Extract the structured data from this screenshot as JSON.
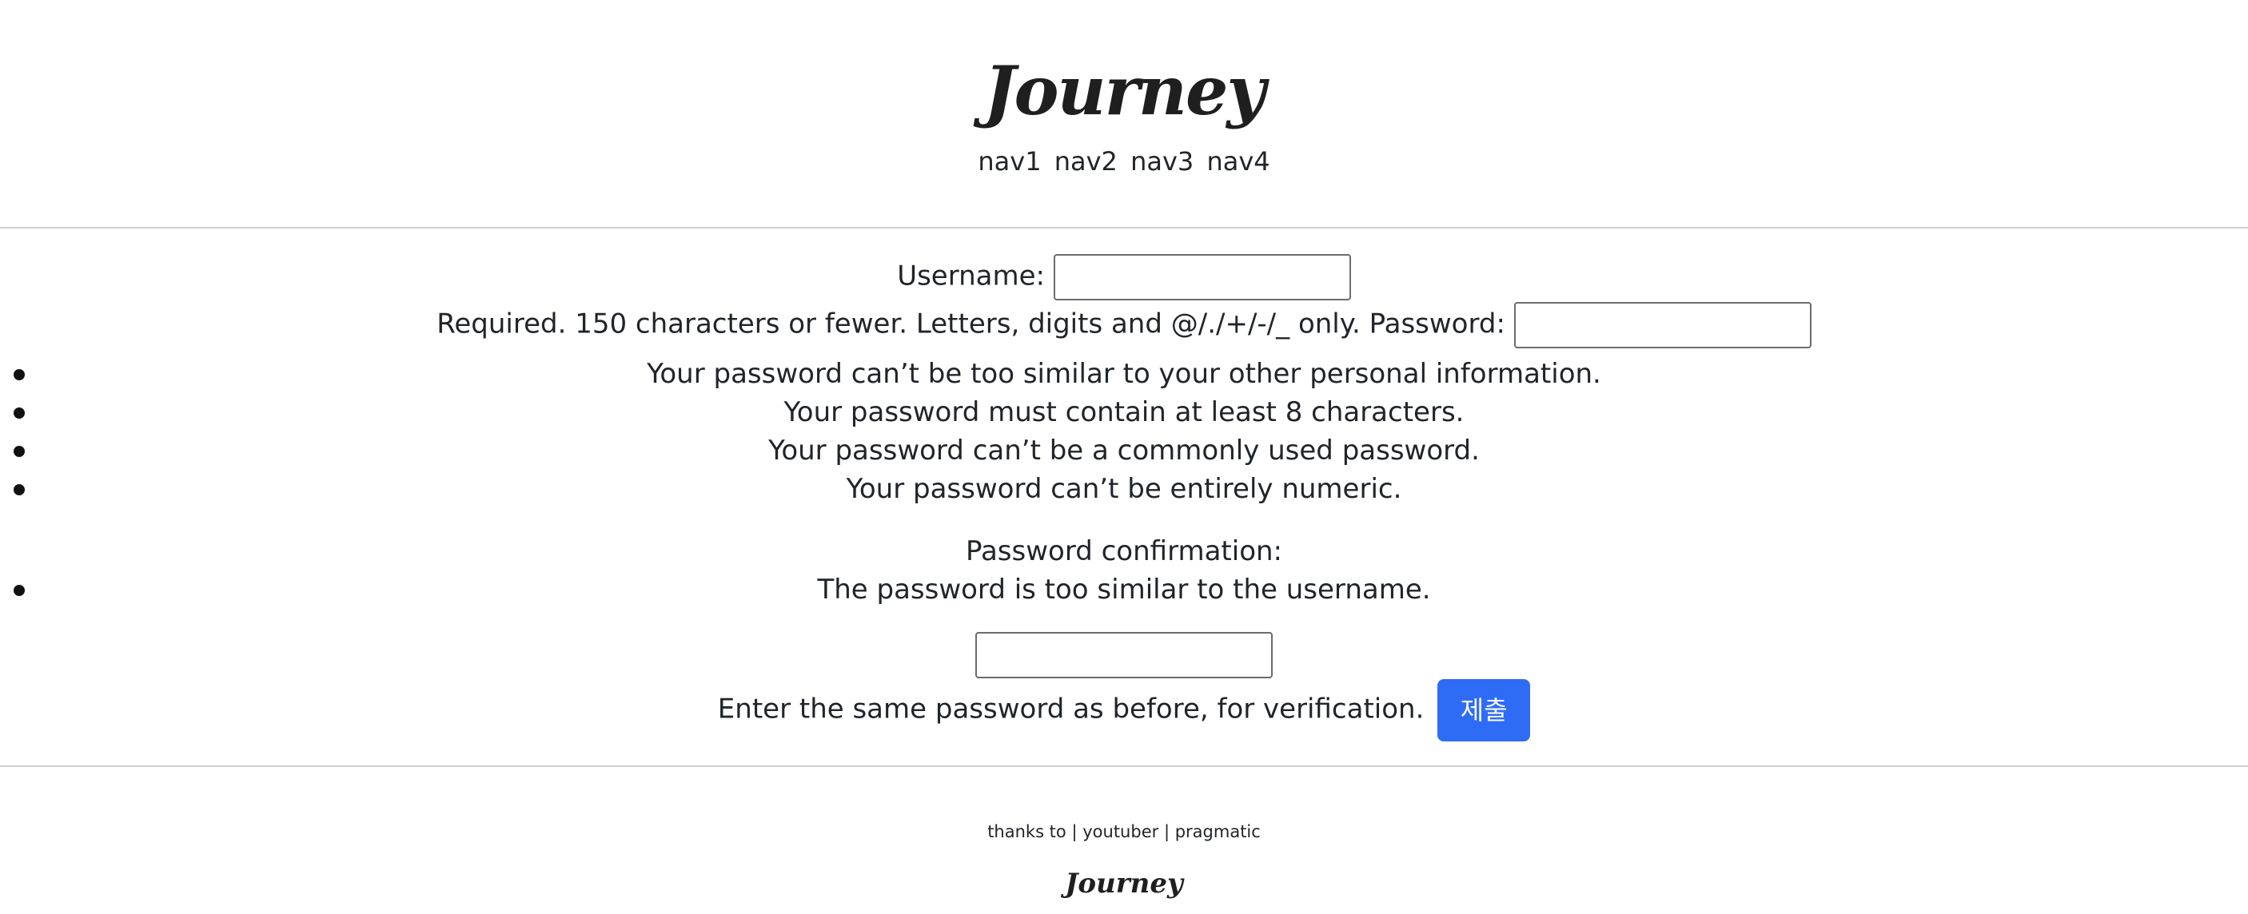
{
  "header": {
    "logo": "Journey",
    "nav": [
      "nav1",
      "nav2",
      "nav3",
      "nav4"
    ]
  },
  "form": {
    "username_label": "Username:",
    "username_value": "",
    "username_help": "Required. 150 characters or fewer. Letters, digits and @/./+/-/_ only.",
    "password_label": "Password:",
    "password_value": "",
    "password_rules": [
      "Your password can’t be too similar to your other personal information.",
      "Your password must contain at least 8 characters.",
      "Your password can’t be a commonly used password.",
      "Your password can’t be entirely numeric."
    ],
    "confirm_label": "Password confirmation:",
    "confirm_errors": [
      "The password is too similar to the username."
    ],
    "confirm_value": "",
    "confirm_help": "Enter the same password as before, for verification.",
    "submit_label": "제출",
    "submit_color": "#2f6cf6"
  },
  "footer": {
    "thanks": "thanks to",
    "sep": "|",
    "link1": "youtuber",
    "link2": "pragmatic",
    "logo": "Journey"
  }
}
